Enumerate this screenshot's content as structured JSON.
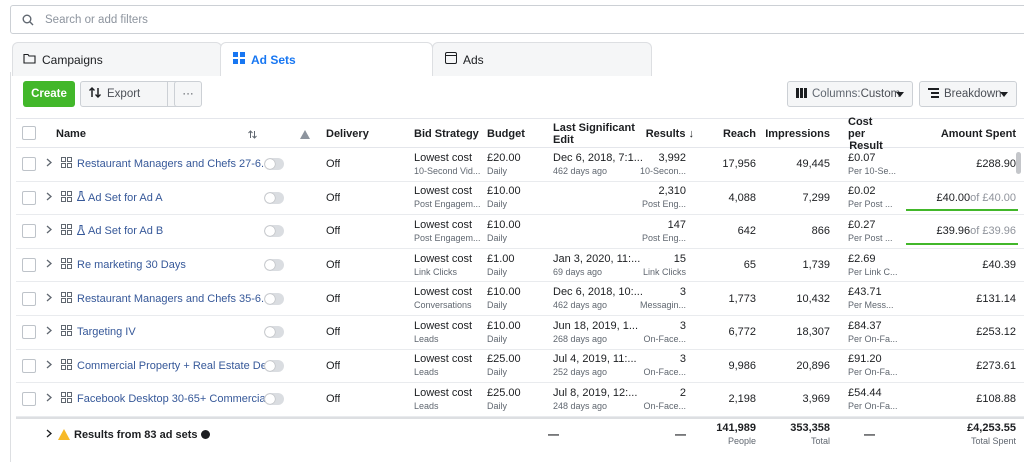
{
  "search": {
    "placeholder": "Search or add filters"
  },
  "tabs": [
    {
      "label": "Campaigns",
      "icon": "folder-icon"
    },
    {
      "label": "Ad Sets",
      "icon": "grid-icon"
    },
    {
      "label": "Ads",
      "icon": "ad-icon"
    }
  ],
  "toolbar": {
    "create_label": "Create",
    "export_label": "Export",
    "more_label": "···",
    "columns_prefix": "Columns: ",
    "columns_value": "Custom",
    "breakdown_label": "Breakdown"
  },
  "headers": {
    "name": "Name",
    "delivery": "Delivery",
    "bid_strategy": "Bid Strategy",
    "budget": "Budget",
    "last_edit_1": "Last Significant",
    "last_edit_2": "Edit",
    "results": "Results ↓",
    "reach": "Reach",
    "impressions": "Impressions",
    "cpr_1": "Cost per",
    "cpr_2": "Result",
    "amount_spent": "Amount Spent"
  },
  "rows": [
    {
      "name": "Restaurant Managers and Chefs 27-6...",
      "delivery": "Off",
      "bid": "Lowest cost",
      "bid_sub": "10-Second Vid...",
      "budget": "£20.00",
      "budget_sub": "Daily",
      "edit": "Dec 6, 2018, 7:1...",
      "edit_sub": "462 days ago",
      "results": "3,992",
      "results_sub": "10-Secon...",
      "reach": "17,956",
      "impressions": "49,445",
      "cpr": "£0.07",
      "cpr_sub": "Per 10-Se...",
      "spent": "£288.90"
    },
    {
      "name": "Ad Set for Ad A",
      "delivery": "Off",
      "bid": "Lowest cost",
      "bid_sub": "Post Engagem...",
      "budget": "£10.00",
      "budget_sub": "Daily",
      "edit": "",
      "edit_sub": "",
      "results": "2,310",
      "results_sub": "Post Eng...",
      "reach": "4,088",
      "impressions": "7,299",
      "cpr": "£0.02",
      "cpr_sub": "Per Post ...",
      "spent": "£40.00",
      "spent_of": " of £40.00"
    },
    {
      "name": "Ad Set for Ad B",
      "delivery": "Off",
      "bid": "Lowest cost",
      "bid_sub": "Post Engagem...",
      "budget": "£10.00",
      "budget_sub": "Daily",
      "edit": "",
      "edit_sub": "",
      "results": "147",
      "results_sub": "Post Eng...",
      "reach": "642",
      "impressions": "866",
      "cpr": "£0.27",
      "cpr_sub": "Per Post ...",
      "spent": "£39.96",
      "spent_of": " of £39.96"
    },
    {
      "name": "Re marketing 30 Days",
      "delivery": "Off",
      "bid": "Lowest cost",
      "bid_sub": "Link Clicks",
      "budget": "£1.00",
      "budget_sub": "Daily",
      "edit": "Jan 3, 2020, 11:...",
      "edit_sub": "69 days ago",
      "results": "15",
      "results_sub": "Link Clicks",
      "reach": "65",
      "impressions": "1,739",
      "cpr": "£2.69",
      "cpr_sub": "Per Link C...",
      "spent": "£40.39"
    },
    {
      "name": "Restaurant Managers and Chefs 35-6...",
      "delivery": "Off",
      "bid": "Lowest cost",
      "bid_sub": "Conversations",
      "budget": "£10.00",
      "budget_sub": "Daily",
      "edit": "Dec 6, 2018, 10:...",
      "edit_sub": "462 days ago",
      "results": "3",
      "results_sub": "Messagin...",
      "reach": "1,773",
      "impressions": "10,432",
      "cpr": "£43.71",
      "cpr_sub": "Per Mess...",
      "spent": "£131.14"
    },
    {
      "name": "Targeting IV",
      "delivery": "Off",
      "bid": "Lowest cost",
      "bid_sub": "Leads",
      "budget": "£10.00",
      "budget_sub": "Daily",
      "edit": "Jun 18, 2019, 1...",
      "edit_sub": "268 days ago",
      "results": "3",
      "results_sub": "On-Face...",
      "reach": "6,772",
      "impressions": "18,307",
      "cpr": "£84.37",
      "cpr_sub": "Per On-Fa...",
      "spent": "£253.12"
    },
    {
      "name": "Commercial Property + Real Estate De...",
      "delivery": "Off",
      "bid": "Lowest cost",
      "bid_sub": "Leads",
      "budget": "£25.00",
      "budget_sub": "Daily",
      "edit": "Jul 4, 2019, 11:...",
      "edit_sub": "252 days ago",
      "results": "3",
      "results_sub": "On-Face...",
      "reach": "9,986",
      "impressions": "20,896",
      "cpr": "£91.20",
      "cpr_sub": "Per On-Fa...",
      "spent": "£273.61"
    },
    {
      "name": "Facebook Desktop 30-65+ Commercia...",
      "delivery": "Off",
      "bid": "Lowest cost",
      "bid_sub": "Leads",
      "budget": "£25.00",
      "budget_sub": "Daily",
      "edit": "Jul 8, 2019, 12:...",
      "edit_sub": "248 days ago",
      "results": "2",
      "results_sub": "On-Face...",
      "reach": "2,198",
      "impressions": "3,969",
      "cpr": "£54.44",
      "cpr_sub": "Per On-Fa...",
      "spent": "£108.88"
    }
  ],
  "summary": {
    "label": "Results from 83 ad sets",
    "edit": "—",
    "results": "—",
    "reach": "141,989",
    "reach_sub": "People",
    "impressions": "353,358",
    "impressions_sub": "Total",
    "cpr": "—",
    "spent": "£4,253.55",
    "spent_sub": "Total Spent"
  },
  "colors": {
    "accent": "#1877f2",
    "create": "#42b72a",
    "link": "#365899",
    "warning": "#f7b928"
  }
}
